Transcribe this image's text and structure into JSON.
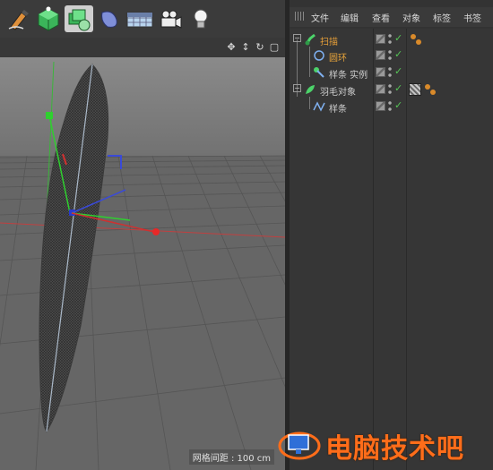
{
  "toolbar": {
    "tools": [
      "pen-spline-tool",
      "cube-primitive",
      "nurbs-generator",
      "deformer-tool",
      "floor-environment",
      "camera-object",
      "light-object"
    ]
  },
  "viewport": {
    "grid_spacing_label": "网格间距 : 100 cm",
    "nav_icons": [
      "move-view-icon",
      "dolly-view-icon",
      "rotate-view-icon",
      "toggle-view-icon"
    ]
  },
  "object_manager": {
    "menu": [
      "文件",
      "编辑",
      "查看",
      "对象",
      "标签",
      "书签"
    ],
    "objects": [
      {
        "name": "扫描",
        "color": "#e59e38",
        "icon": "sweep-icon",
        "has_tag": true
      },
      {
        "name": "圆环",
        "color": "#e8a43a",
        "icon": "circle-spline-icon",
        "has_tag": false
      },
      {
        "name": "样条 实例",
        "color": "#cfcfcf",
        "icon": "spline-instance-icon",
        "has_tag": false
      },
      {
        "name": "羽毛对象",
        "color": "#cfcfcf",
        "icon": "feather-object-icon",
        "has_tag": true
      },
      {
        "name": "样条",
        "color": "#cfcfcf",
        "icon": "spline-icon",
        "has_tag": false
      }
    ]
  },
  "watermark": {
    "text": "电脑技术吧"
  },
  "colors": {
    "accent_orange": "#ff6d1a",
    "check_green": "#56c456",
    "sweep_green": "#4cd36a"
  }
}
